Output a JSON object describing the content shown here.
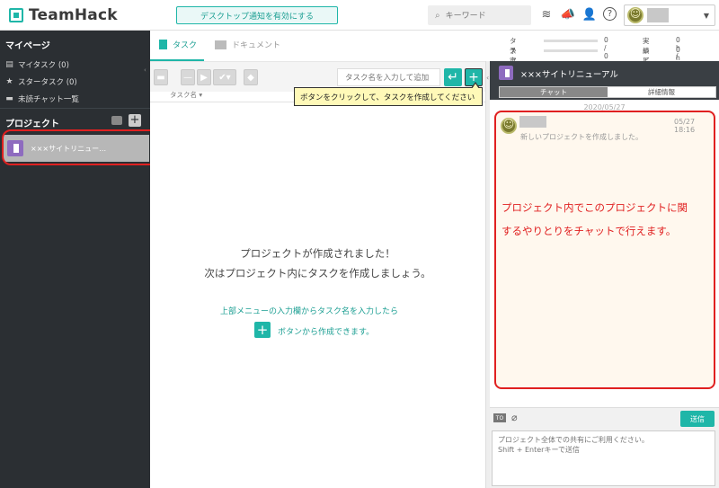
{
  "header": {
    "brand": "TeamHack",
    "notify_button": "デスクトップ通知を有効にする",
    "search_placeholder": "キーワード"
  },
  "sidebar": {
    "mypage_heading": "マイページ",
    "items": [
      {
        "label": "マイタスク (0)",
        "icon": "task-icon"
      },
      {
        "label": "スタータスク (0)",
        "icon": "star-icon"
      },
      {
        "label": "未読チャット一覧",
        "icon": "chat-icon"
      }
    ],
    "project_heading": "プロジェクト",
    "projects": [
      {
        "label": "×××サイトリニュー…",
        "color": "#8e6bbf"
      }
    ]
  },
  "main": {
    "tabs": [
      {
        "label": "タスク",
        "active": true
      },
      {
        "label": "ドキュメント",
        "active": false
      }
    ],
    "stats": {
      "task_count_label": "タスク数",
      "task_count_value": "0 / 0",
      "planned_hours_label": "予定工数",
      "actual_hours_label": "実績工数",
      "actual_hours_value": "0 h / 0 h",
      "review_label": "レビュー",
      "review_value": "0 h / 0 h"
    },
    "task_input_placeholder": "タスク名を入力して追加",
    "column_header": "タスク名 ▾",
    "tooltip": "ボタンをクリックして、タスクを作成してください",
    "empty_title_1": "プロジェクトが作成されました！",
    "empty_title_2": "次はプロジェクト内にタスクを作成しましょう。",
    "hint_1": "上部メニューの入力欄からタスク名を入力したら",
    "hint_2": "ボタンから作成できます。"
  },
  "right_panel": {
    "project_title": "×××サイトリニューアル",
    "tabs": [
      {
        "label": "チャット",
        "active": true
      },
      {
        "label": "詳細情報",
        "active": false
      }
    ],
    "chat_date": "2020/05/27",
    "message": {
      "time": "05/27 18:16",
      "text": "新しいプロジェクトを作成しました。"
    },
    "annotation_line_1": "プロジェクト内でこのプロジェクトに関",
    "annotation_line_2": "するやりとりをチャットで行えます。",
    "compose": {
      "to_label": "TO",
      "send_label": "送信",
      "placeholder": "プロジェクト全体での共有にご利用ください。\nShift + Enterキーで送信"
    }
  },
  "colors": {
    "accent": "#1fb6a8",
    "sidebar_bg": "#2b2f33",
    "annotation_red": "#e02020",
    "project_purple": "#8e6bbf"
  }
}
